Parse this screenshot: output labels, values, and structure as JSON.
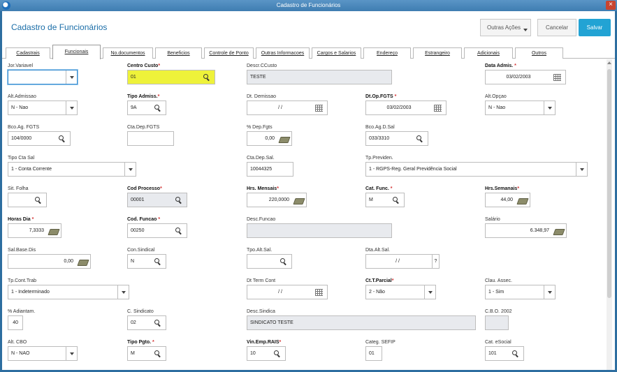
{
  "window_title": "Cadastro de Funcionários",
  "header": {
    "title": "Cadastro de Funcionários",
    "actions_label": "Outras Ações",
    "cancel_label": "Cancelar",
    "save_label": "Salvar",
    "save_color": "#22a3d4"
  },
  "tabs": [
    "Cadastrais",
    "Funcionais",
    "No.documentos",
    "Beneficios",
    "Controle de Ponto",
    "Outras Informacoes",
    "Cargos e Salarios",
    "Endereço",
    "Estrangeiro",
    "Adicionais",
    "Outros"
  ],
  "active_tab": "Funcionais",
  "fields": {
    "jor_variavel": {
      "label": "Jor.Variavel",
      "value": ""
    },
    "centro_custo": {
      "label": "Centro Custo",
      "value": "01"
    },
    "descr_ccusto": {
      "label": "Descr.CCusto",
      "value": "TESTE"
    },
    "data_admis": {
      "label": "Data Admis.",
      "value": "03/02/2003"
    },
    "alt_admissao": {
      "label": "Alt.Admissao",
      "value": "N - Nao"
    },
    "tipo_admiss": {
      "label": "Tipo Admiss.",
      "value": "9A"
    },
    "dt_demissao": {
      "label": "Dt. Demissao",
      "value": "/ /"
    },
    "dt_op_fgts": {
      "label": "Dt.Op.FGTS",
      "value": "03/02/2003"
    },
    "alt_opcao": {
      "label": "Alt.Opçao",
      "value": "N - Nao"
    },
    "bco_ag_fgts": {
      "label": "Bco.Ag. FGTS",
      "value": "104/0000"
    },
    "cta_dep_fgts": {
      "label": "Cta.Dep.FGTS",
      "value": ""
    },
    "pct_dep_fgts": {
      "label": "% Dep.Fgts",
      "value": "0,00"
    },
    "bco_ag_d_sal": {
      "label": "Bco.Ag.D.Sal",
      "value": "033/3310"
    },
    "tipo_cta_sal": {
      "label": "Tipo Cta Sal",
      "value": "1 - Conta Corrente"
    },
    "cta_dep_sal": {
      "label": "Cta.Dep.Sal.",
      "value": "10044325"
    },
    "tp_previden": {
      "label": "Tp.Previden.",
      "value": "1 - RGPS-Reg. Geral Previdência Social"
    },
    "sit_folha": {
      "label": "Sit. Folha",
      "value": ""
    },
    "cod_processo": {
      "label": "Cod Processo",
      "value": "00001"
    },
    "hrs_mensais": {
      "label": "Hrs. Mensais",
      "value": "220,0000"
    },
    "cat_func": {
      "label": "Cat. Func.",
      "value": "M"
    },
    "hrs_semanais": {
      "label": "Hrs.Semanais",
      "value": "44,00"
    },
    "horas_dia": {
      "label": "Horas Dia",
      "value": "7,3333"
    },
    "cod_funcao": {
      "label": "Cod. Funcao",
      "value": "00250"
    },
    "desc_funcao": {
      "label": "Desc.Funcao",
      "value": ""
    },
    "salario": {
      "label": "Salário",
      "value": "6.348,97"
    },
    "sal_base_dis": {
      "label": "Sal.Base.Dis",
      "value": "0,00"
    },
    "con_sindical": {
      "label": "Con.Sindical",
      "value": "N"
    },
    "tpo_alt_sal": {
      "label": "Tpo.Alt.Sal.",
      "value": ""
    },
    "dta_alt_sal": {
      "label": "Dta.Alt.Sal.",
      "value": "/ /"
    },
    "tp_cont_trab": {
      "label": "Tp.Cont.Trab",
      "value": "1 - Indeterminado"
    },
    "dt_term_cont": {
      "label": "Dt Term Cont",
      "value": "/ /"
    },
    "ct_t_parcial": {
      "label": "Ct.T.Parcial",
      "value": "2 - Não"
    },
    "clau_assec": {
      "label": "Clau. Assec.",
      "value": "1 - Sim"
    },
    "pct_adiantam": {
      "label": "% Adiantam.",
      "value": "40"
    },
    "c_sindicato": {
      "label": "C. Sindicato",
      "value": "02"
    },
    "desc_sindica": {
      "label": "Desc.Sindica",
      "value": "SINDICATO TESTE"
    },
    "cbo_2002": {
      "label": "C.B.O. 2002",
      "value": ""
    },
    "alt_cbo": {
      "label": "Alt. CBO",
      "value": "N - NAO"
    },
    "tipo_pgto": {
      "label": "Tipo Pgto.",
      "value": "M"
    },
    "vin_emp_rais": {
      "label": "Vin.Emp.RAIS",
      "value": "10"
    },
    "categ_sefip": {
      "label": "Categ. SEFIP",
      "value": "01"
    },
    "cat_esocial": {
      "label": "Cat. eSocial",
      "value": "101"
    }
  }
}
